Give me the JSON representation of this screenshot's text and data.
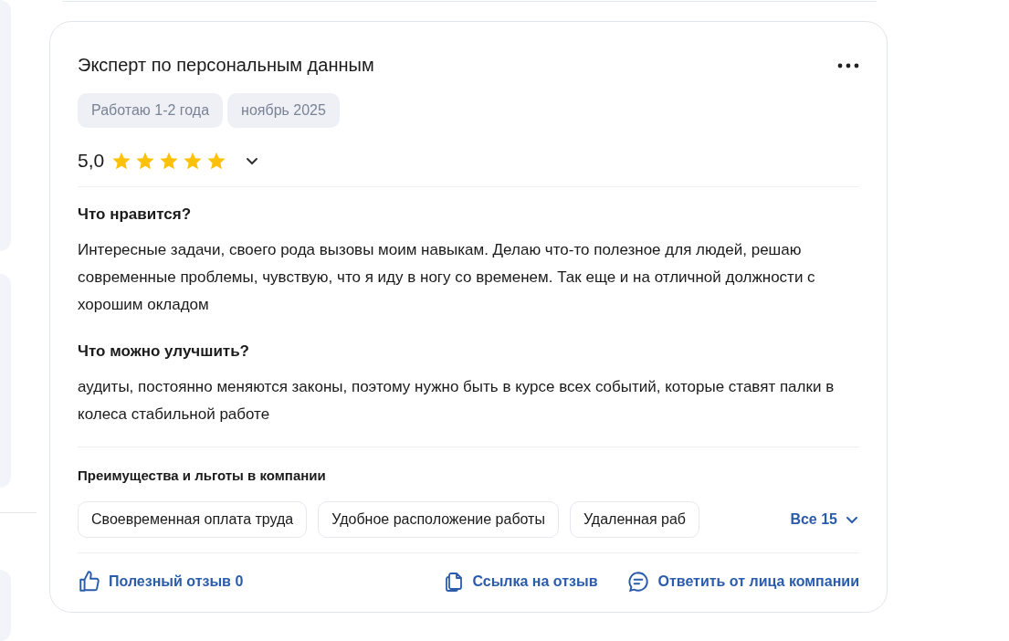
{
  "review": {
    "title": "Эксперт по персональным данным",
    "tags": [
      "Работаю 1-2 года",
      "ноябрь 2025"
    ],
    "rating": "5,0",
    "stars": 5,
    "details_expanded": false,
    "sections": [
      {
        "heading": "Что нравится?",
        "text": "Интересные задачи, своего рода вызовы моим навыкам. Делаю что-то полезное для людей, решаю современные проблемы, чувствую, что я иду в ногу со временем. Так еще и на отличной должности с хорошим окладом"
      },
      {
        "heading": "Что можно улучшить?",
        "text": "аудиты, постоянно меняются законы, поэтому нужно быть в курсе всех событий, которые ставят палки в колеса стабильной работе"
      }
    ],
    "benefits": {
      "heading": "Преимущества и льготы в компании",
      "items": [
        "Своевременная оплата труда",
        "Удобное расположение работы",
        "Удаленная раб"
      ],
      "more": "Все 15"
    },
    "actions": [
      {
        "kind": "like",
        "label": "Полезный отзыв 0"
      },
      {
        "kind": "link",
        "label": "Ссылка на отзыв"
      },
      {
        "kind": "reply",
        "label": "Ответить от лица компании"
      }
    ]
  }
}
